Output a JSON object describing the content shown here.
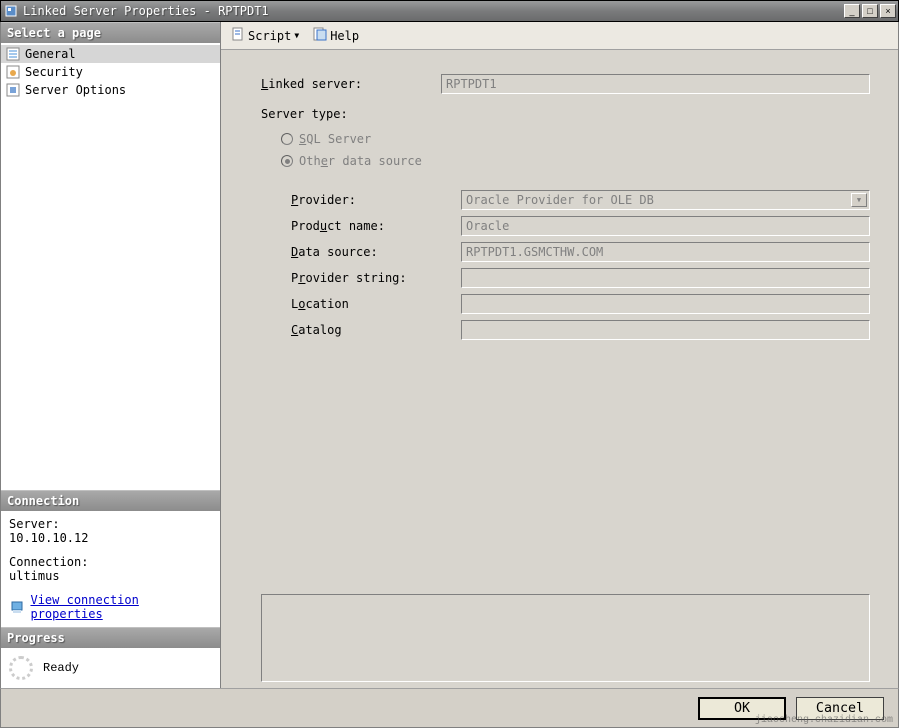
{
  "title": "Linked Server Properties - RPTPDT1",
  "titlebar_buttons": {
    "minimize": "_",
    "maximize": "□",
    "close": "×"
  },
  "sidebar": {
    "select_header": "Select a page",
    "pages": [
      {
        "label": "General",
        "selected": true
      },
      {
        "label": "Security",
        "selected": false
      },
      {
        "label": "Server Options",
        "selected": false
      }
    ],
    "connection_header": "Connection",
    "server_label": "Server:",
    "server_value": "10.10.10.12",
    "connection_label": "Connection:",
    "connection_value": "ultimus",
    "view_conn_link": "View connection properties",
    "progress_header": "Progress",
    "progress_status": "Ready"
  },
  "toolbar": {
    "script_label": "Script",
    "help_label": "Help"
  },
  "form": {
    "linked_server_label": "Linked server:",
    "linked_server_value": "RPTPDT1",
    "server_type_label": "Server type:",
    "radio_sql": "SQL Server",
    "radio_other": "Other data source",
    "selected_type": "other",
    "provider_label": "Provider:",
    "provider_value": "Oracle Provider for OLE DB",
    "product_label": "Product name:",
    "product_value": "Oracle",
    "datasource_label": "Data source:",
    "datasource_value": "RPTPDT1.GSMCTHW.COM",
    "provider_string_label": "Provider string:",
    "provider_string_value": "",
    "location_label": "Location",
    "location_value": "",
    "catalog_label": "Catalog",
    "catalog_value": ""
  },
  "footer": {
    "ok_label": "OK",
    "cancel_label": "Cancel"
  },
  "watermark": "jiaocheng.chazidian.com"
}
